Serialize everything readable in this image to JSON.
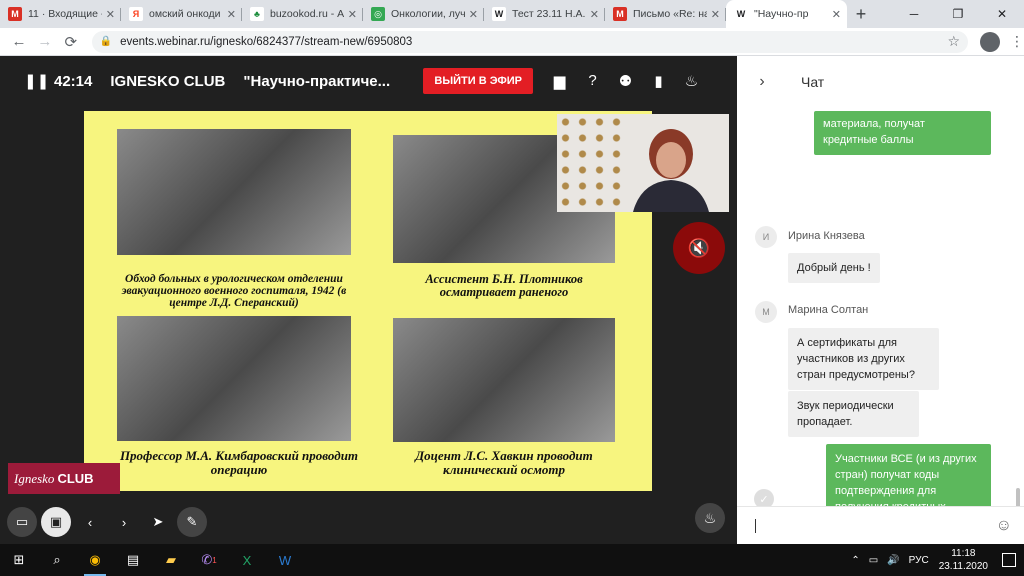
{
  "browser": {
    "tabs": [
      {
        "title": "11 · Входящие -",
        "favicon": "gmail-icon",
        "color": "#d93025"
      },
      {
        "title": "омский онкоди",
        "favicon": "yandex-icon",
        "color": "#fc3f1d"
      },
      {
        "title": "buzookod.ru - А",
        "favicon": "clover-icon",
        "color": "#1e8e3e"
      },
      {
        "title": "Онкологии, луч",
        "favicon": "globe-icon",
        "color": "#34a853"
      },
      {
        "title": "Тест 23.11 Н.А.",
        "favicon": "word-icon",
        "color": "#2b579a"
      },
      {
        "title": "Письмо «Re: на",
        "favicon": "gmail-icon",
        "color": "#d93025"
      },
      {
        "title": "\"Научно-пр",
        "favicon": "webinar-icon",
        "color": "#202124",
        "active": true
      }
    ],
    "url": "events.webinar.ru/ignesko/6824377/stream-new/6950803"
  },
  "stage": {
    "timer": "42:14",
    "club": "IGNESKO CLUB",
    "title": "\"Научно-практиче...",
    "live_button": "ВЫЙТИ В ЭФИР"
  },
  "slide": {
    "captions": [
      "Обход больных в урологическом отделении эвакуационного военного госпиталя, 1942 (в центре Л.Д. Сперанский)",
      "Ассистент Б.Н. Плотников осматривает раненого",
      "Профессор М.А. Кимбаровский проводит операцию",
      "Доцент Л.С. Хавкин проводит клинический осмотр"
    ]
  },
  "logo": {
    "part1": "Ignesko",
    "part2": "CLUB"
  },
  "chat": {
    "header": "Чат",
    "messages": [
      {
        "own": true,
        "text": "материала, получат кредитные баллы"
      },
      {
        "author": "Ирина Князева",
        "initial": "И",
        "texts": [
          "Добрый день !"
        ]
      },
      {
        "author": "Марина Солтан",
        "initial": "М",
        "texts": [
          "А сертификаты для участников из других стран предусмотрены?",
          "Звук периодически пропадает."
        ]
      },
      {
        "own": true,
        "text": "Участники ВСЕ (и из других стран) получат коды подтверждения для получения кредитных баллов.  Или напишите мне (адрес на сайте НМО)"
      }
    ]
  },
  "taskbar": {
    "lang": "РУС",
    "time": "11:18",
    "date": "23.11.2020",
    "viber_badge": "1"
  }
}
